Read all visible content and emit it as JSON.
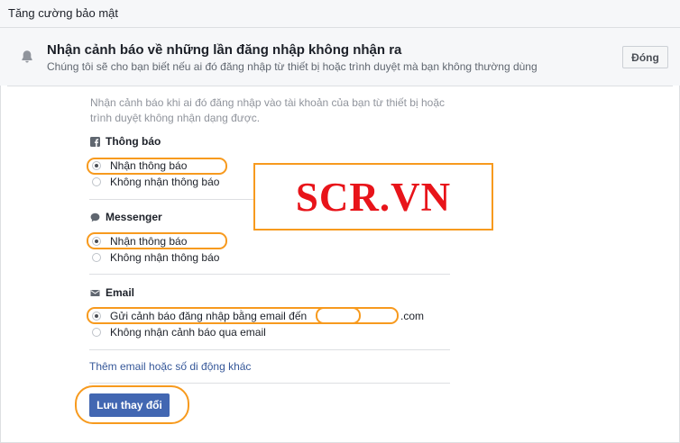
{
  "section": {
    "title": "Tăng cường bảo mật"
  },
  "alert": {
    "icon": "bell-icon",
    "heading": "Nhận cảnh báo về những lần đăng nhập không nhận ra",
    "subtitle": "Chúng tôi sẽ cho bạn biết nếu ai đó đăng nhập từ thiết bị hoặc trình duyệt mà bạn không thường dùng",
    "close_label": "Đóng"
  },
  "description": "Nhận cảnh báo khi ai đó đăng nhập vào tài khoản của bạn từ thiết bị hoặc trình duyệt không nhận dạng được.",
  "groups": {
    "notifications": {
      "icon": "facebook-icon",
      "label": "Thông báo",
      "options": [
        "Nhận thông báo",
        "Không nhận thông báo"
      ],
      "selected": "Nhận thông báo"
    },
    "messenger": {
      "icon": "speech-bubble-icon",
      "label": "Messenger",
      "options": [
        "Nhận thông báo",
        "Không nhận thông báo"
      ],
      "selected": "Nhận thông báo"
    },
    "email": {
      "icon": "envelope-icon",
      "label": "Email",
      "options": [
        "Gửi cảnh báo đăng nhập bằng email đến",
        "Không nhận cảnh báo qua email"
      ],
      "email_suffix": ".com",
      "selected": "Gửi cảnh báo đăng nhập bằng email đến"
    }
  },
  "add_contact_link": "Thêm email hoặc số di động khác",
  "save_label": "Lưu thay đổi",
  "watermark": "SCR.VN",
  "colors": {
    "accent_blue": "#4267b2",
    "link_blue": "#365899",
    "highlight_orange": "#f79a1e",
    "watermark_red": "#e8141a"
  }
}
